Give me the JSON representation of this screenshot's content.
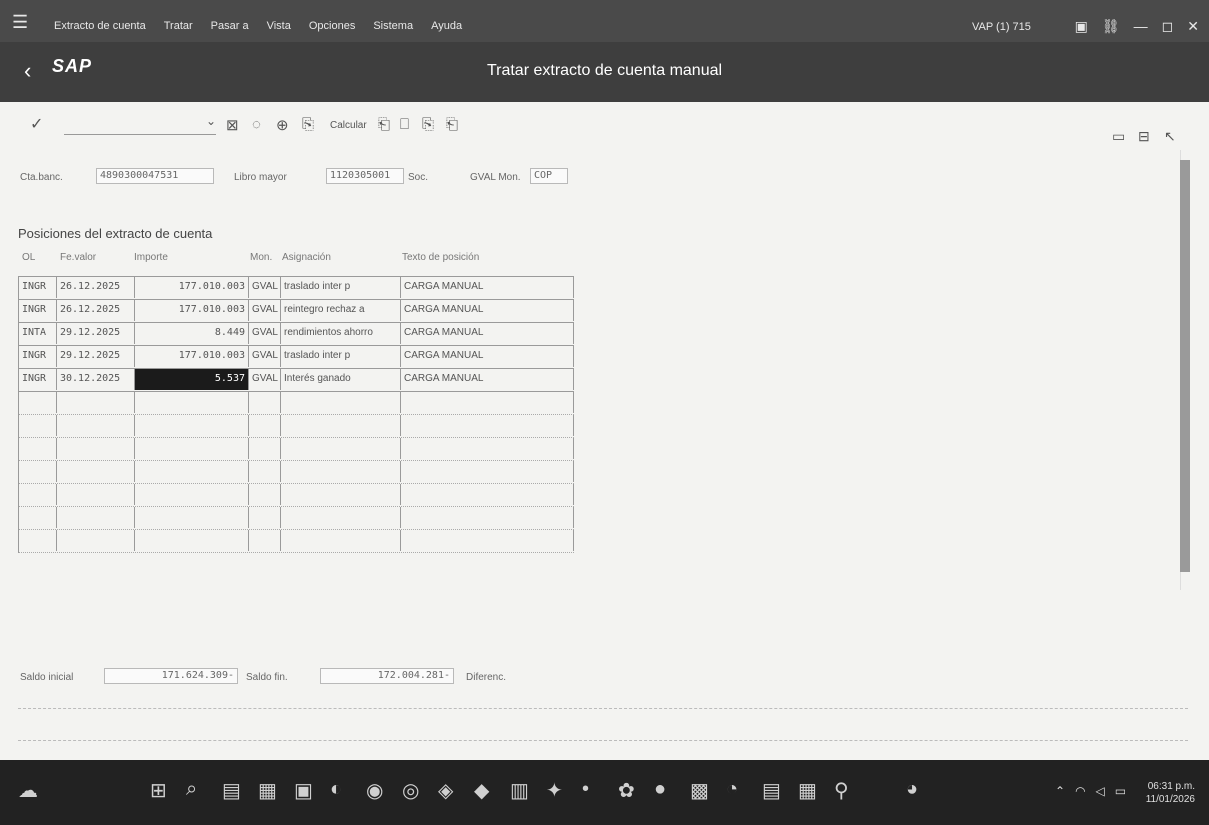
{
  "menubar": {
    "items": [
      "Extracto de cuenta",
      "Tratar",
      "Pasar a",
      "Vista",
      "Opciones",
      "Sistema",
      "Ayuda"
    ],
    "system_id": "VAP (1) 715"
  },
  "titlebar": {
    "logo": "SAP",
    "title": "Tratar extracto de cuenta manual"
  },
  "toolbar": {
    "calc_label": "Calcular"
  },
  "header": {
    "bank_account_label": "Cta.banc.",
    "bank_account_value": "4890300047531",
    "ledger_label": "Libro mayor",
    "ledger_value": "1120305001",
    "doc_label": "Soc.",
    "currency_label": "GVAL Mon.",
    "currency_value": "COP"
  },
  "section": {
    "title": "Posiciones del extracto de cuenta"
  },
  "table": {
    "headers": [
      "OL",
      "Fe.valor",
      "Importe",
      "Mon.",
      "Asignación",
      "Texto de posición"
    ],
    "rows": [
      {
        "code": "INGR",
        "date": "26.12.2025",
        "amount": "177.010.003",
        "cur": "GVAL",
        "assign": "traslado inter p",
        "text": "CARGA MANUAL"
      },
      {
        "code": "INGR",
        "date": "26.12.2025",
        "amount": "177.010.003",
        "cur": "GVAL",
        "assign": "reintegro rechaz a",
        "text": "CARGA MANUAL"
      },
      {
        "code": "INTA",
        "date": "29.12.2025",
        "amount": "8.449",
        "cur": "GVAL",
        "assign": "rendimientos ahorro",
        "text": "CARGA MANUAL"
      },
      {
        "code": "INGR",
        "date": "29.12.2025",
        "amount": "177.010.003",
        "cur": "GVAL",
        "assign": "traslado inter p",
        "text": "CARGA MANUAL"
      },
      {
        "code": "INGR",
        "date": "30.12.2025",
        "amount": "5.537",
        "cur": "GVAL",
        "assign": "Interés ganado",
        "text": "CARGA MANUAL"
      }
    ],
    "empty_rows": 7
  },
  "footer": {
    "initial_label": "Saldo inicial",
    "initial_value": "171.624.309-",
    "final_label": "Saldo fin.",
    "final_value": "172.004.281-",
    "diff_label": "Diferenc."
  },
  "taskbar": {
    "time": "06:31 p.m.",
    "date": "11/01/2026"
  }
}
